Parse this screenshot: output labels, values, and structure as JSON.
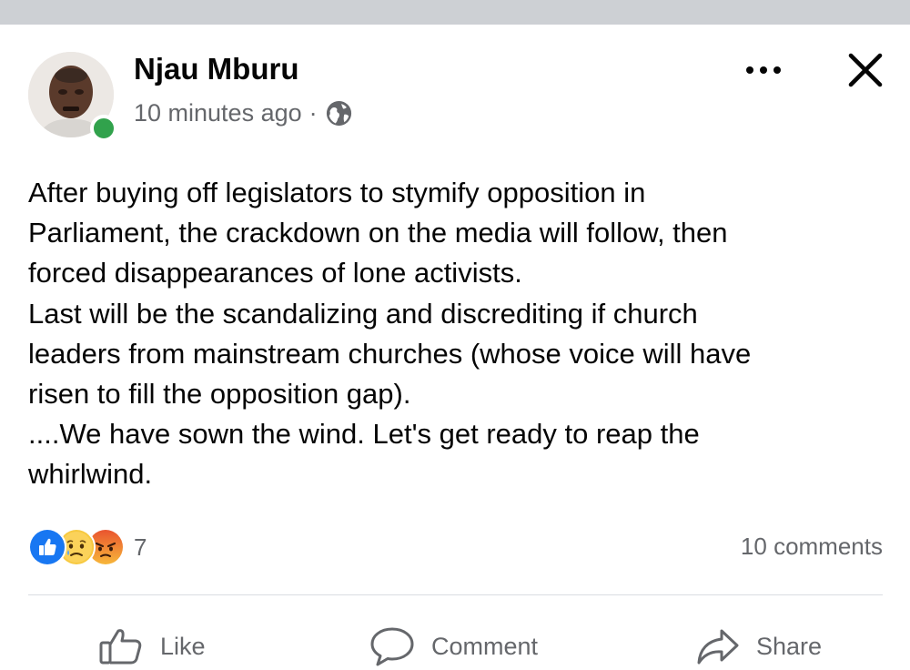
{
  "post": {
    "author": {
      "name": "Njau Mburu",
      "online": true
    },
    "timestamp": "10 minutes ago",
    "separator": "·",
    "privacy_icon": "globe-icon",
    "text": "After buying off legislators to stymify opposition in\nParliament, the crackdown on the media will follow, then\nforced disappearances of lone activists.\nLast will be the scandalizing and discrediting if church\nleaders from mainstream churches (whose voice will have\nrisen to fill the opposition gap).\n....We have sown the wind. Let's get ready to reap the\nwhirlwind.",
    "reactions": {
      "types": [
        "like",
        "sad",
        "angry"
      ],
      "count": "7"
    },
    "comments_label": "10 comments"
  },
  "actions": {
    "like": "Like",
    "comment": "Comment",
    "share": "Share"
  },
  "colors": {
    "online": "#31a24c",
    "like_blue": "#1877f2",
    "meta_gray": "#65676b",
    "top_strip": "#cdd0d4"
  }
}
